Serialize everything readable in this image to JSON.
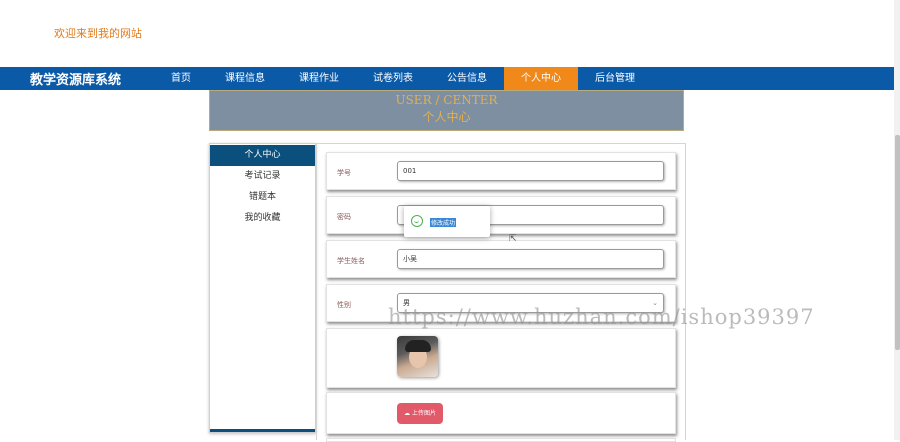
{
  "header": {
    "welcome": "欢迎来到我的网站"
  },
  "nav": {
    "brand": "教学资源库系统",
    "items": [
      {
        "label": "首页",
        "active": false
      },
      {
        "label": "课程信息",
        "active": false
      },
      {
        "label": "课程作业",
        "active": false
      },
      {
        "label": "试卷列表",
        "active": false
      },
      {
        "label": "公告信息",
        "active": false
      },
      {
        "label": "个人中心",
        "active": true
      },
      {
        "label": "后台管理",
        "active": false
      }
    ]
  },
  "banner": {
    "title_en": "USER / CENTER",
    "title_cn": "个人中心"
  },
  "sidebar": {
    "items": [
      {
        "label": "个人中心",
        "active": true
      },
      {
        "label": "考试记录",
        "active": false
      },
      {
        "label": "错题本",
        "active": false
      },
      {
        "label": "我的收藏",
        "active": false
      }
    ]
  },
  "form": {
    "student_id": {
      "label": "学号",
      "value": "001"
    },
    "password": {
      "label": "密码",
      "value": ""
    },
    "name": {
      "label": "学生姓名",
      "value": "小吴"
    },
    "gender": {
      "label": "性别",
      "value": "男"
    },
    "upload_label": "上传图片"
  },
  "toast": {
    "message": "修改成功"
  },
  "watermark": "https://www.huzhan.com/ishop39397",
  "colors": {
    "nav_bg": "#0b5aa8",
    "active_tab": "#f0881a",
    "sidebar_active": "#0b4f7c",
    "upload_btn": "#e05a6a",
    "success": "#4cb050"
  }
}
